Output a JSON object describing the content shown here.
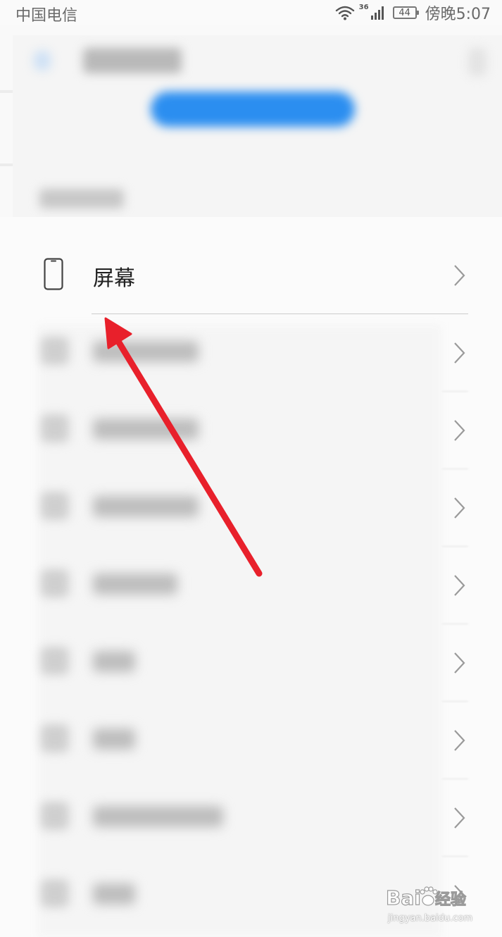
{
  "status_bar": {
    "carrier": "中国电信",
    "network_type": "36",
    "battery_level": "44",
    "time": "傍晚5:07"
  },
  "settings": {
    "items": [
      {
        "label": "屏幕",
        "icon": "phone-outline-icon"
      }
    ]
  },
  "annotation": {
    "arrow_color": "#e8202b"
  },
  "watermark": {
    "brand": "Baidu经验",
    "domain": "jingyan.baidu.com"
  },
  "colors": {
    "accent_blue": "#2b8ef0",
    "text_primary": "#222222",
    "divider": "#cccccc"
  }
}
